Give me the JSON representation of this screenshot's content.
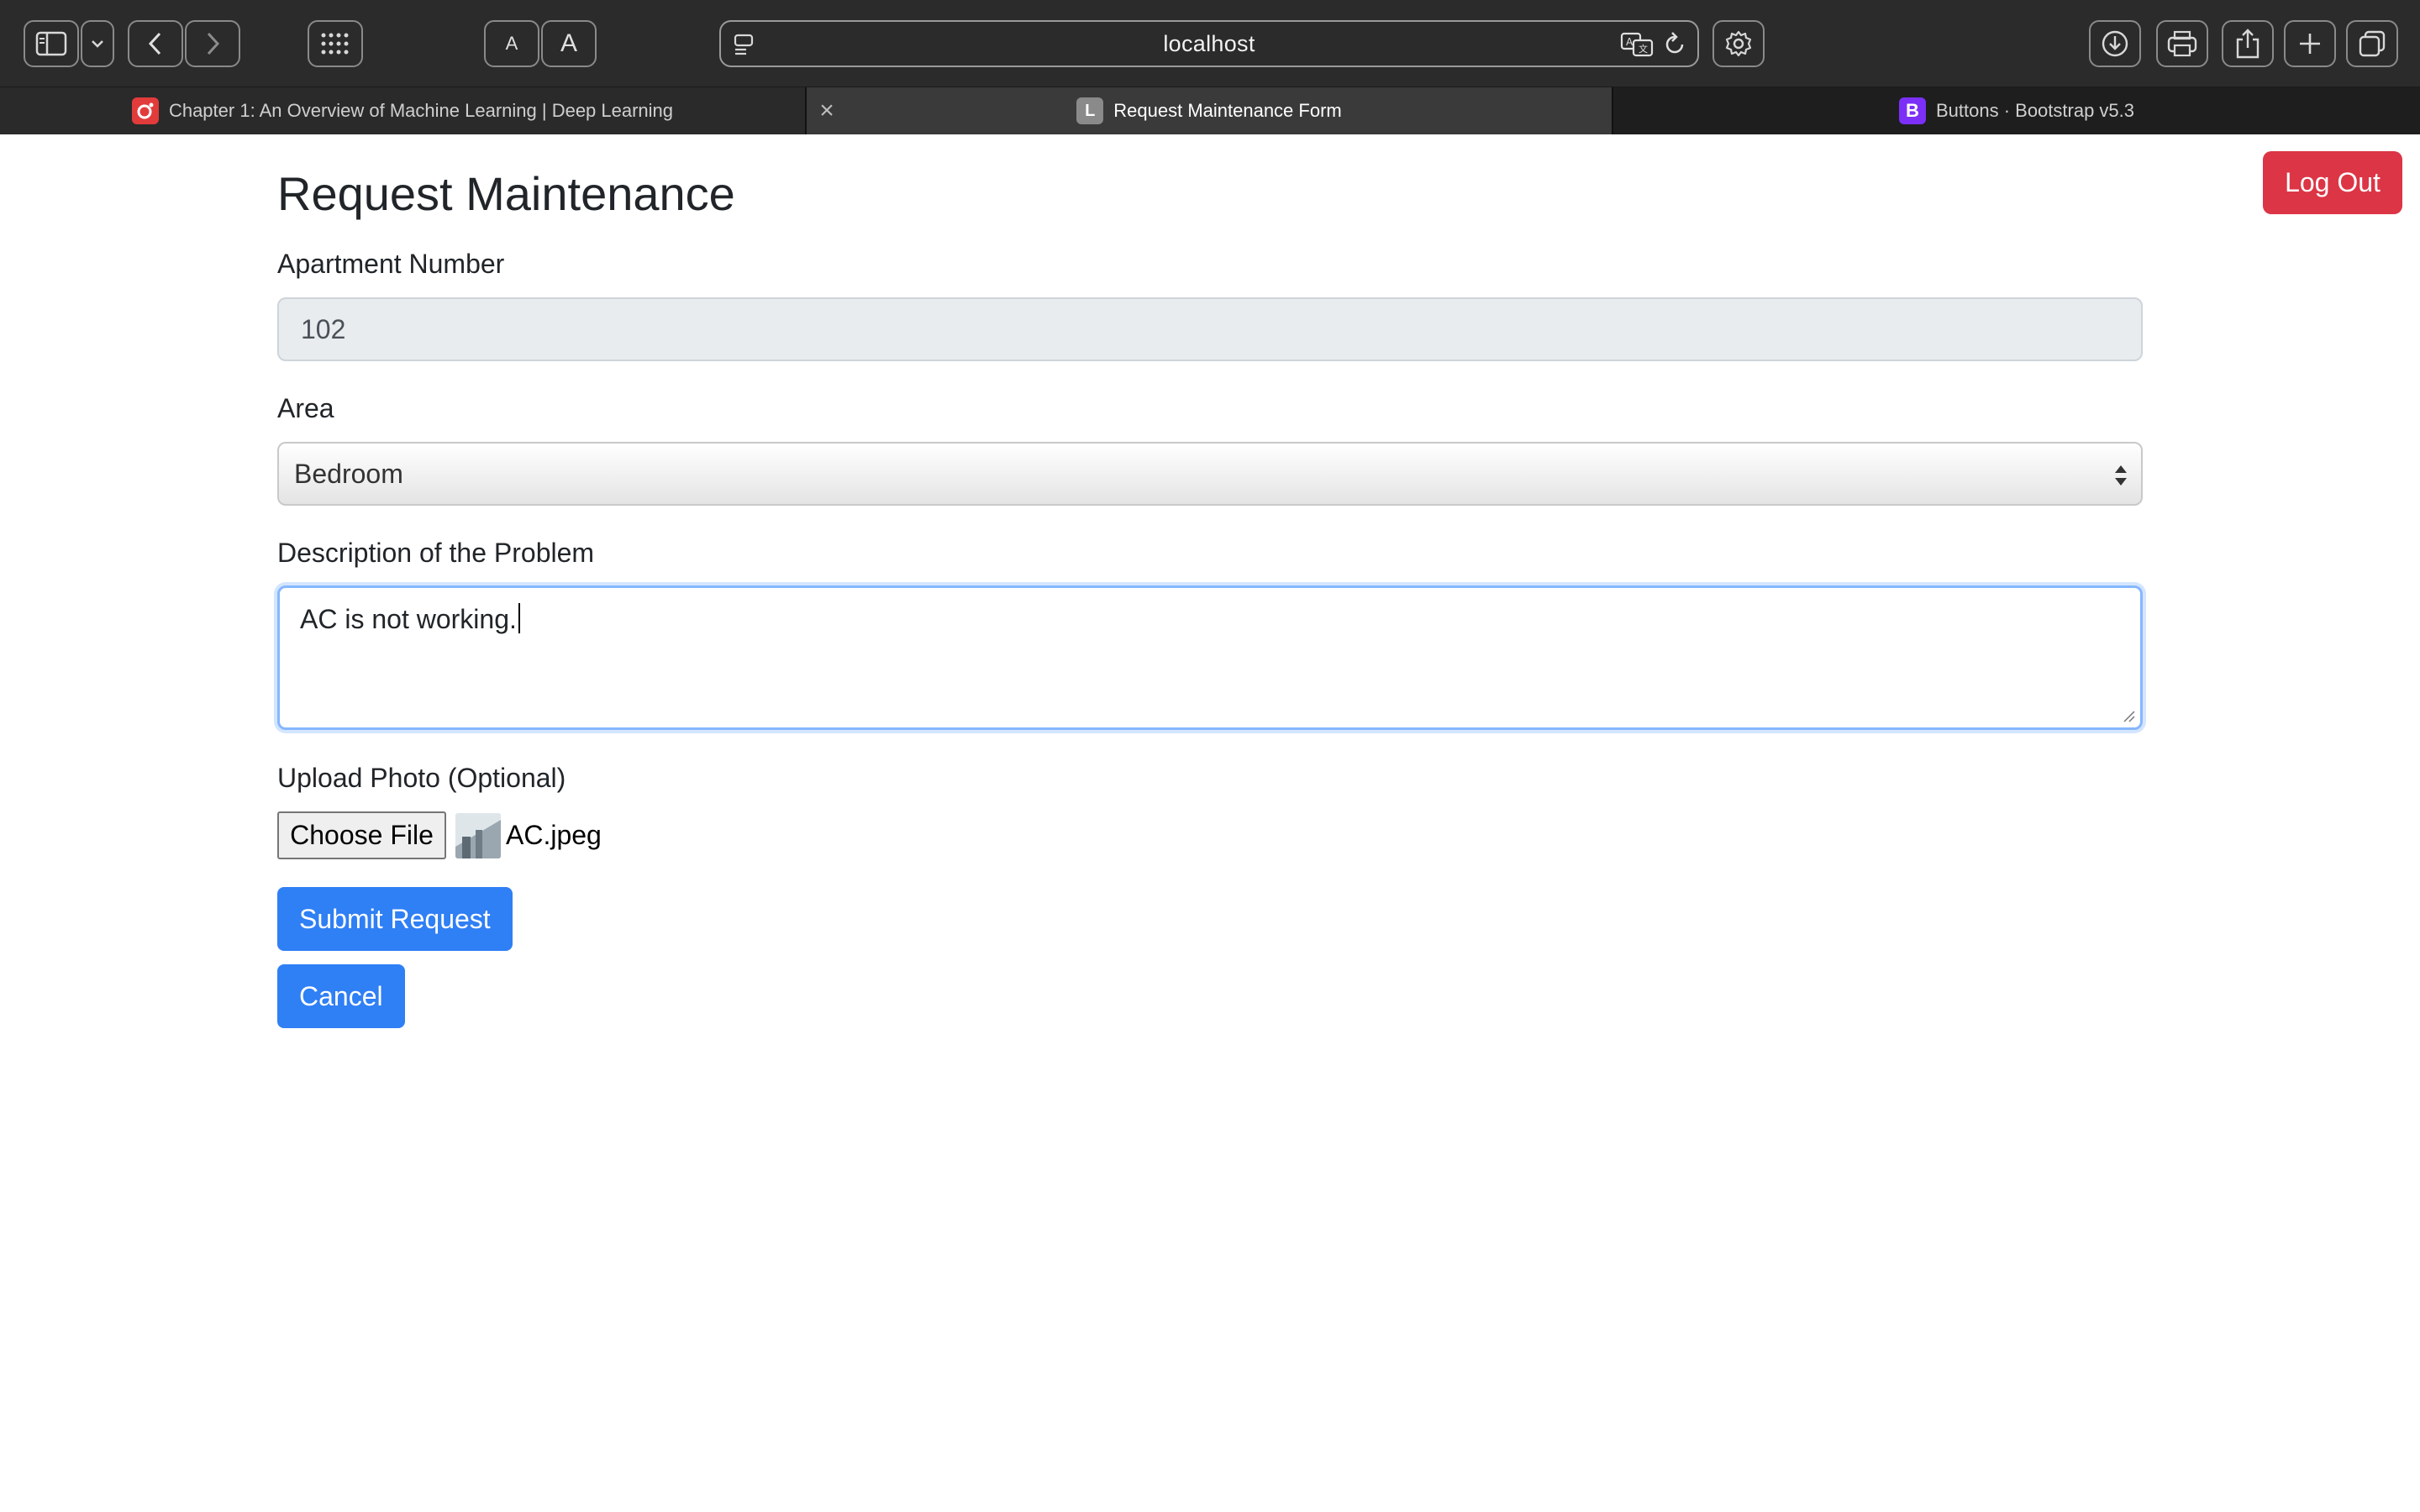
{
  "browser": {
    "address": "localhost",
    "font_small_label": "A",
    "font_large_label": "A",
    "tabs": [
      {
        "title": "Chapter 1: An Overview of Machine Learning | Deep Learning",
        "favicon": "O"
      },
      {
        "title": "Request Maintenance Form",
        "favicon": "L"
      },
      {
        "title": "Buttons · Bootstrap v5.3",
        "favicon": "B"
      }
    ],
    "tab_close_glyph": "×"
  },
  "page": {
    "logout_label": "Log Out",
    "title": "Request Maintenance",
    "apartment": {
      "label": "Apartment Number",
      "value": "102"
    },
    "area": {
      "label": "Area",
      "value": "Bedroom"
    },
    "description": {
      "label": "Description of the Problem",
      "value": "AC is not working."
    },
    "upload": {
      "label": "Upload Photo (Optional)",
      "button_label": "Choose File",
      "file_name": "AC.jpeg"
    },
    "submit_label": "Submit Request",
    "cancel_label": "Cancel"
  },
  "colors": {
    "primary": "#2f7ff5",
    "danger": "#dc3545",
    "focus_border": "#86b7fe",
    "disabled_input_bg": "#e9ecef"
  },
  "icons": [
    "sidebar-icon",
    "chevron-down-icon",
    "back-icon",
    "forward-icon",
    "grid-icon",
    "page-menu-icon",
    "translate-icon",
    "reload-icon",
    "gear-icon",
    "download-icon",
    "print-icon",
    "share-icon",
    "plus-icon",
    "tabs-overview-icon"
  ]
}
